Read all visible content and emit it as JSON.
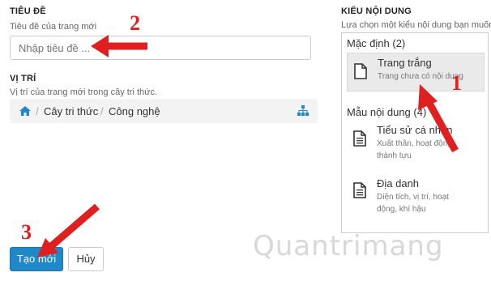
{
  "title_section": {
    "heading": "TIÊU ĐỀ",
    "subtitle": "Tiêu đề của trang mới",
    "input_placeholder": "Nhập tiêu đề ..."
  },
  "location_section": {
    "heading": "VỊ TRÍ",
    "subtitle": "Vị trí của trang mới trong cây tri thức.",
    "breadcrumb": [
      "Cây tri thức",
      "Công nghệ"
    ],
    "separator": "/"
  },
  "content_type_section": {
    "heading": "KIỂU NỘI DUNG",
    "subtitle": "Lựa chọn một kiểu nội dung bạn muốn",
    "default_group": {
      "label": "Mặc định (2)",
      "items": [
        {
          "name": "Trang trắng",
          "desc": "Trang chưa có nội dung"
        }
      ]
    },
    "template_group": {
      "label": "Mẫu nội dung (4)",
      "items": [
        {
          "name": "Tiểu sử cá nhân",
          "desc": "Xuất thân, hoạt động, thành tựu"
        },
        {
          "name": "Địa danh",
          "desc": "Diện tích, vị trí, hoạt động, khí hậu"
        }
      ]
    }
  },
  "actions": {
    "create_label": "Tạo mới",
    "cancel_label": "Hủy"
  },
  "annotations": {
    "n1": "1",
    "n2": "2",
    "n3": "3",
    "color": "#e02020"
  },
  "watermark": "Quantrimang",
  "colors": {
    "primary_button": "#1e88c8",
    "link_icon": "#1e88c8"
  }
}
